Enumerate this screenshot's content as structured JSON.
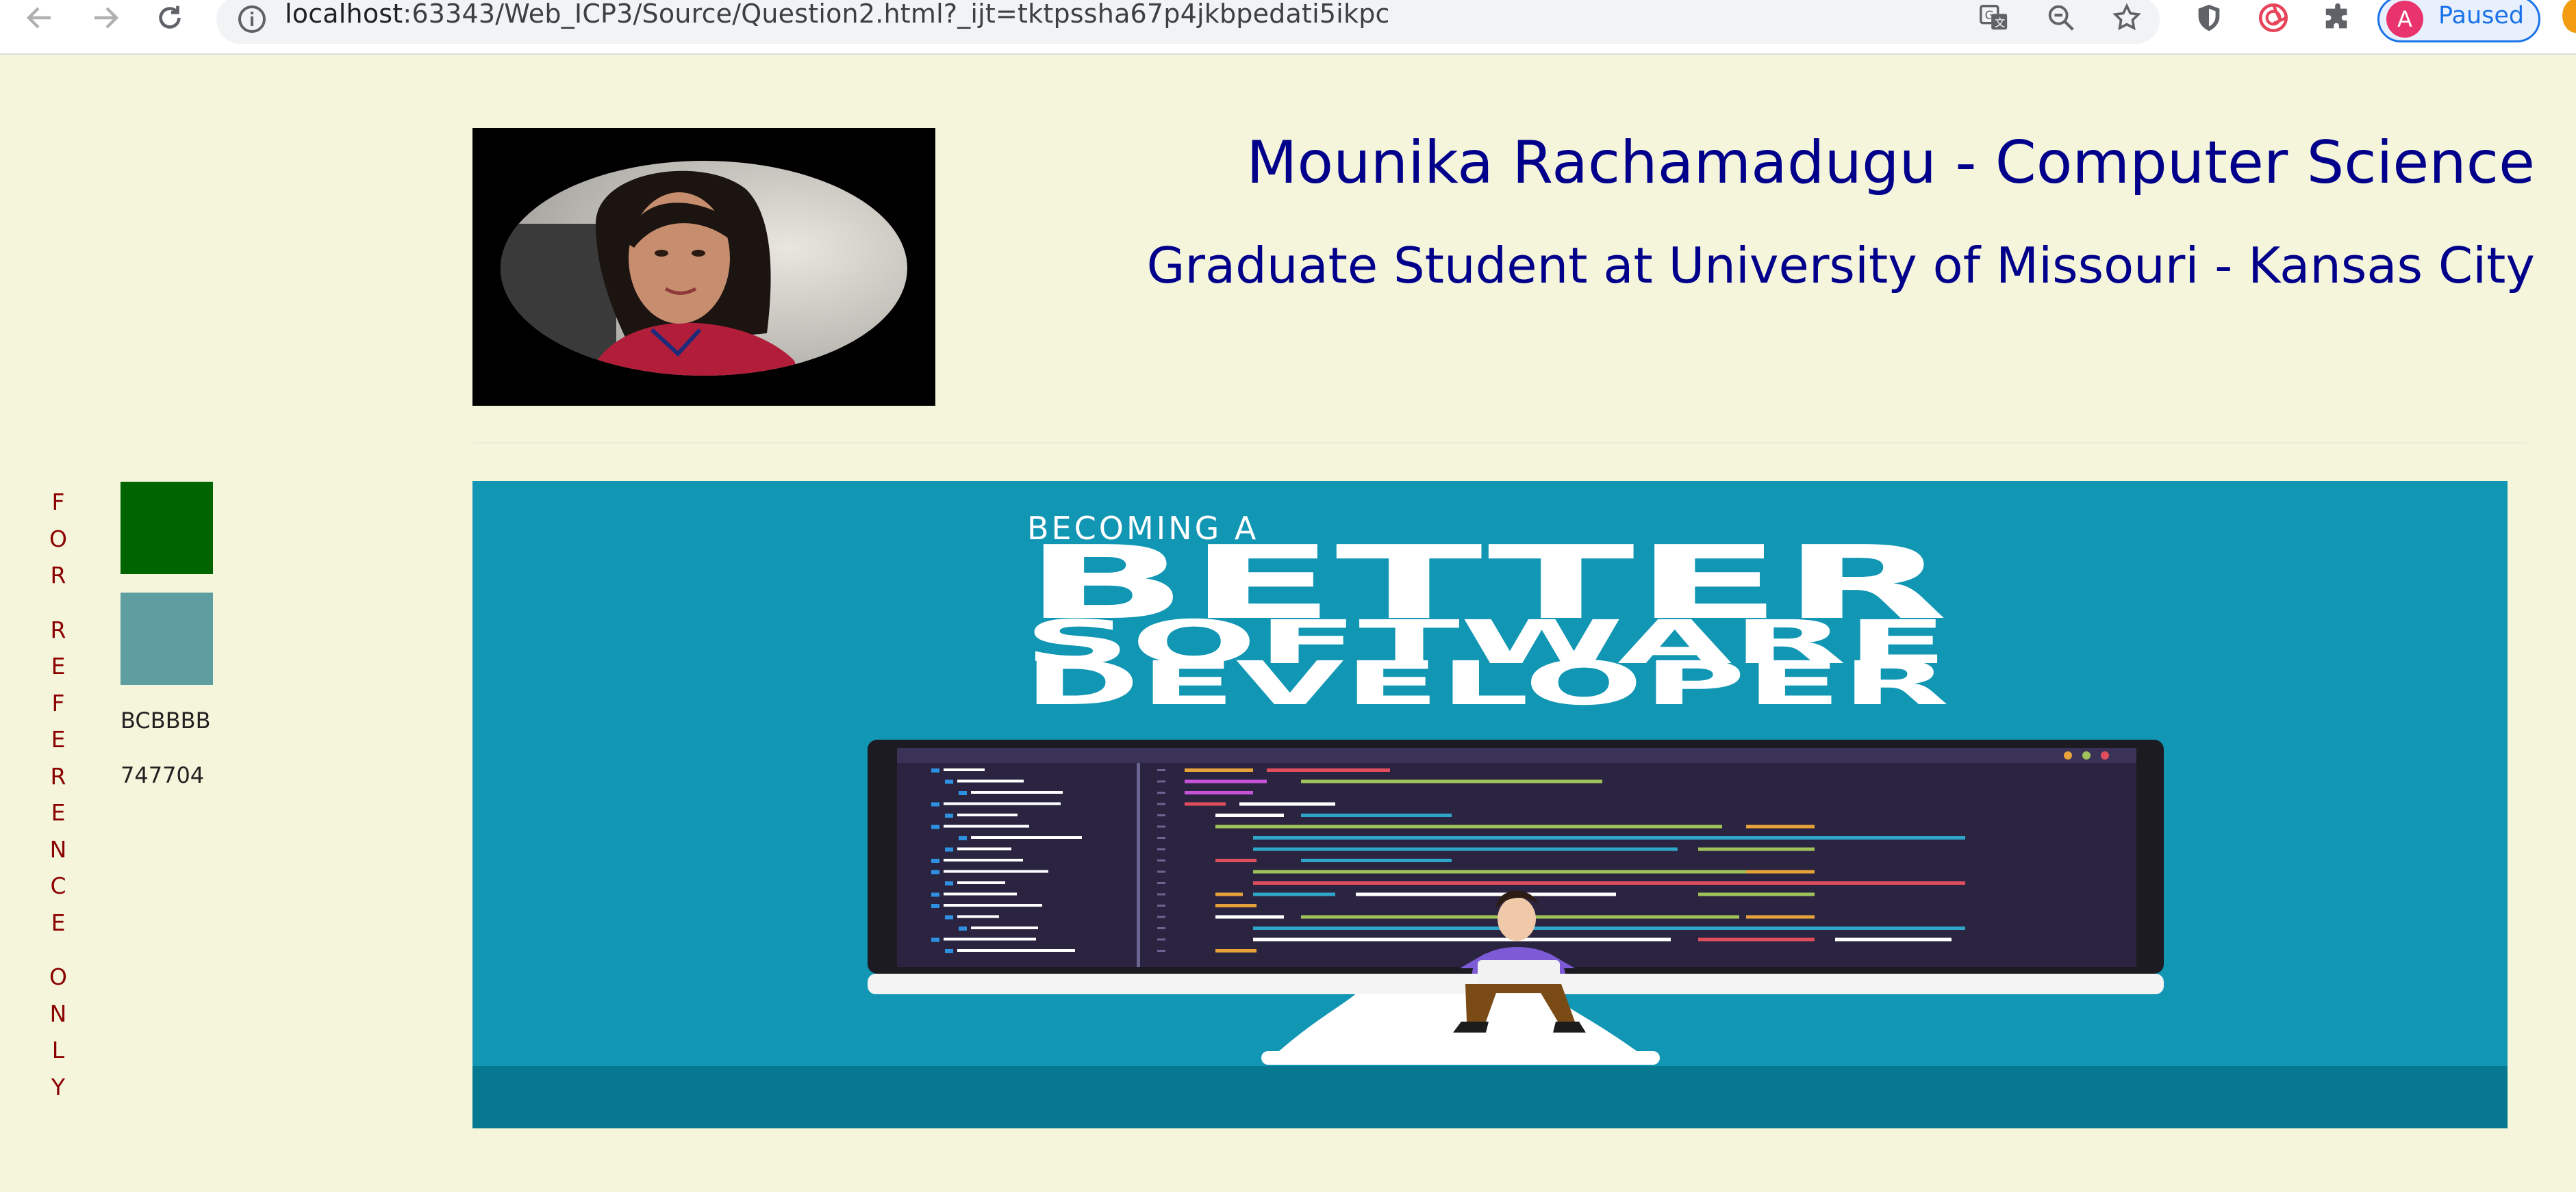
{
  "browser": {
    "url_host": "localhost",
    "url_rest": ":63343/Web_ICP3/Source/Question2.html?_ijt=tktpssha67p4jkbpedati5ikpc",
    "profile_initial": "A",
    "profile_status": "Paused"
  },
  "header": {
    "title": "Mounika Rachamadugu - Computer Science",
    "subtitle": "Graduate Student at University of Missouri - Kansas City"
  },
  "reference": {
    "vertical_words": [
      "FOR",
      "REFERENCE",
      "ONLY"
    ],
    "swatches": [
      {
        "color": "#006400"
      },
      {
        "color": "#5f9ea0"
      }
    ],
    "codes": [
      "BCBBBB",
      "747704"
    ]
  },
  "banner": {
    "line1": "BECOMING A",
    "line2": "BETTER",
    "line3": "SOFTWARE",
    "line4": "DEVELOPER"
  },
  "colors": {
    "page_bg": "#f5f5dc",
    "heading": "#00008b",
    "reference_text": "#8b0000",
    "banner_bg": "#1196b4"
  }
}
